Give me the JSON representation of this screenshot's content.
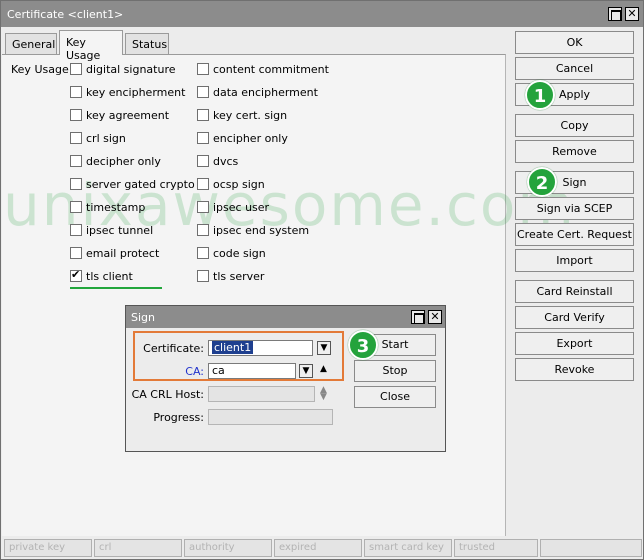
{
  "window": {
    "title": "Certificate <client1>"
  },
  "tabs": [
    {
      "label": "General"
    },
    {
      "label": "Key Usage",
      "active": true
    },
    {
      "label": "Status"
    }
  ],
  "key_usage": {
    "label": "Key Usage:",
    "left": [
      {
        "label": "digital signature",
        "checked": false
      },
      {
        "label": "key encipherment",
        "checked": false
      },
      {
        "label": "key agreement",
        "checked": false
      },
      {
        "label": "crl sign",
        "checked": false
      },
      {
        "label": "decipher only",
        "checked": false
      },
      {
        "label": "server gated crypto",
        "checked": false
      },
      {
        "label": "timestamp",
        "checked": false
      },
      {
        "label": "ipsec tunnel",
        "checked": false
      },
      {
        "label": "email protect",
        "checked": false
      },
      {
        "label": "tls client",
        "checked": true
      }
    ],
    "right": [
      {
        "label": "content commitment",
        "checked": false
      },
      {
        "label": "data encipherment",
        "checked": false
      },
      {
        "label": "key cert. sign",
        "checked": false
      },
      {
        "label": "encipher only",
        "checked": false
      },
      {
        "label": "dvcs",
        "checked": false
      },
      {
        "label": "ocsp sign",
        "checked": false
      },
      {
        "label": "ipsec user",
        "checked": false
      },
      {
        "label": "ipsec end system",
        "checked": false
      },
      {
        "label": "code sign",
        "checked": false
      },
      {
        "label": "tls server",
        "checked": false
      }
    ]
  },
  "side_buttons": {
    "ok": "OK",
    "cancel": "Cancel",
    "apply": "Apply",
    "copy": "Copy",
    "remove": "Remove",
    "sign": "Sign",
    "sign_via_scep": "Sign via SCEP",
    "create_cert_request": "Create Cert. Request",
    "import": "Import",
    "card_reinstall": "Card Reinstall",
    "card_verify": "Card Verify",
    "export": "Export",
    "revoke": "Revoke"
  },
  "badges": {
    "one": "1",
    "two": "2",
    "three": "3"
  },
  "watermark": "unixawesome.com",
  "status_bar": [
    "private key",
    "crl",
    "authority",
    "expired",
    "smart card key",
    "trusted"
  ],
  "sign_dialog": {
    "title": "Sign",
    "certificate_label": "Certificate:",
    "certificate_value": "client1",
    "ca_label": "CA:",
    "ca_value": "ca",
    "ca_crl_host_label": "CA CRL Host:",
    "ca_crl_host_value": "",
    "progress_label": "Progress:",
    "progress_value": "",
    "start": "Start",
    "stop": "Stop",
    "close": "Close"
  },
  "colors": {
    "badge_green": "#24a33c",
    "highlight_orange": "#e37a38",
    "ca_label_blue": "#2233cc",
    "underline_green": "#22a63c"
  }
}
